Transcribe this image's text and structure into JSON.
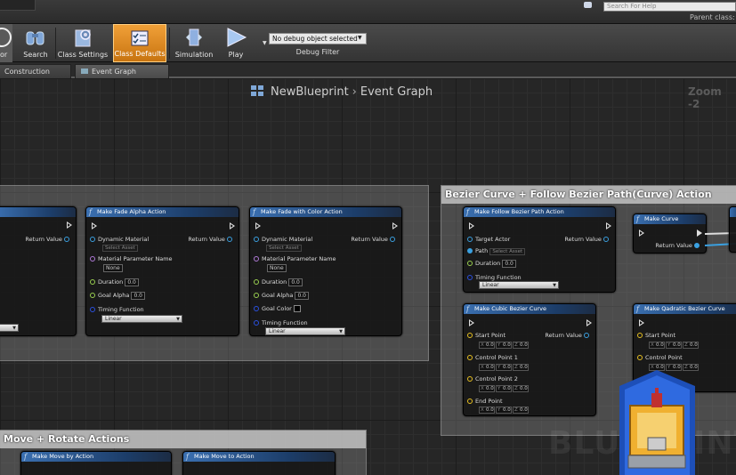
{
  "topbar": {
    "search_placeholder": "Search For Help",
    "parent_class": "Parent class:"
  },
  "toolbar": {
    "search": "Search",
    "class_settings": "Class Settings",
    "class_defaults": "Class Defaults",
    "simulation": "Simulation",
    "play": "Play",
    "debug_selected": "No debug object selected",
    "debug_filter": "Debug Filter",
    "left_label": "or",
    "accent_color": "#e8901e"
  },
  "tabs": [
    "Construction Script",
    "Event Graph"
  ],
  "graph": {
    "breadcrumb_root": "NewBlueprint",
    "breadcrumb_leaf": "Event Graph",
    "zoom": "Zoom -2"
  },
  "comments": {
    "bezier": "Bezier Curve + Follow Bezier Path(Curve) Action",
    "move_rotate": "Move + Rotate Actions"
  },
  "nodes": {
    "fade_alpha": {
      "title": "Make Fade Alpha Action",
      "dynamic_material": "Dynamic Material",
      "select_asset": "Select Asset",
      "return_value": "Return Value",
      "param_name": "Material Parameter Name",
      "param_value": "None",
      "duration": "Duration",
      "duration_value": "0.0",
      "goal_alpha": "Goal Alpha",
      "goal_alpha_value": "0.0",
      "timing": "Timing Function",
      "timing_value": "Linear"
    },
    "fade_color": {
      "title": "Make Fade with Color Action",
      "dynamic_material": "Dynamic Material",
      "select_asset": "Select Asset",
      "return_value": "Return Value",
      "param_name": "Material Parameter Name",
      "param_value": "None",
      "duration": "Duration",
      "duration_value": "0.0",
      "goal_alpha": "Goal Alpha",
      "goal_alpha_value": "0.0",
      "goal_color": "Goal Color",
      "timing": "Timing Function",
      "timing_value": "Linear"
    },
    "follow_bezier": {
      "title": "Make Follow Bezier Path Action",
      "target_actor": "Target Actor",
      "return_value": "Return Value",
      "path": "Path",
      "select_asset": "Select Asset",
      "duration": "Duration",
      "duration_value": "0.0",
      "timing": "Timing Function",
      "timing_value": "Linear"
    },
    "make_curve": {
      "title": "Make Curve",
      "return_value": "Return Value"
    },
    "cubic_bezier": {
      "title": "Make Cubic Bezier Curve",
      "start_point": "Start Point",
      "return_value": "Return Value",
      "control_point_1": "Control Point 1",
      "control_point_2": "Control Point 2",
      "end_point": "End Point",
      "axis_x": "X",
      "axis_y": "Y",
      "axis_z": "Z",
      "zero": "0.0"
    },
    "quad_bezier": {
      "title": "Make Qadratic Bezier Curve",
      "start_point": "Start Point",
      "control_point": "Control Point",
      "axis_x": "X",
      "axis_y": "Y",
      "axis_z": "Z",
      "zero": "0.0"
    },
    "left_partial": {
      "return_value": "Return Value"
    },
    "move_by": {
      "title": "Make Move by Action"
    },
    "move_to": {
      "title": "Make Move to Action"
    }
  },
  "watermark": "BLUEPRINT"
}
